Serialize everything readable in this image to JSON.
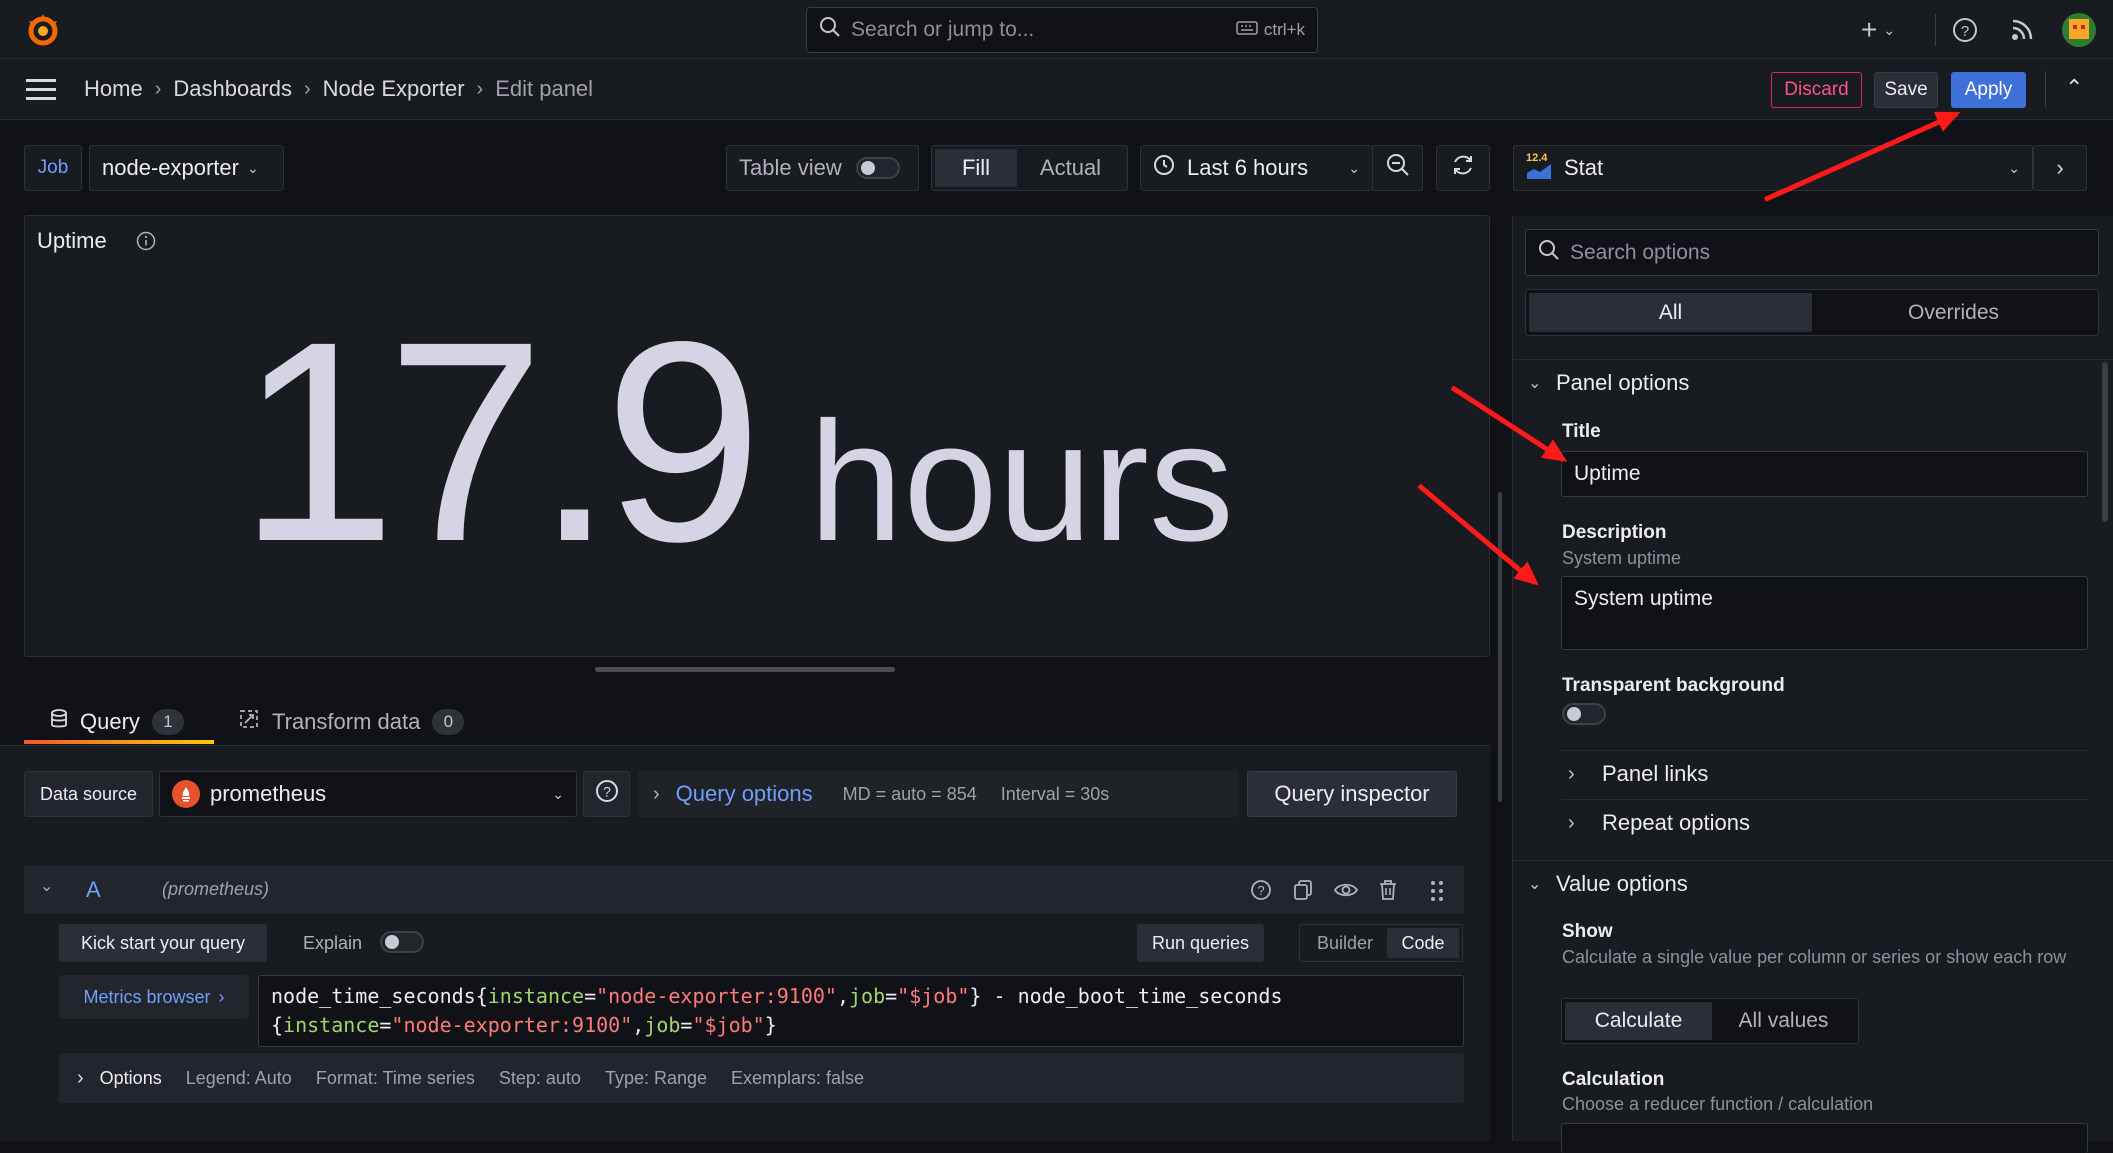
{
  "colors": {
    "accent": "#3d71d9",
    "discard": "#ff5286",
    "query_tab_underline": "#f05a28",
    "link_blue": "#6e9fff"
  },
  "topbar": {
    "search_placeholder": "Search or jump to...",
    "shortcut": "ctrl+k"
  },
  "breadcrumb": {
    "items": [
      "Home",
      "Dashboards",
      "Node Exporter"
    ],
    "current": "Edit panel"
  },
  "actions": {
    "discard": "Discard",
    "save": "Save",
    "apply": "Apply"
  },
  "variables": {
    "label": "Job",
    "value": "node-exporter"
  },
  "toolbar": {
    "table_view": "Table view",
    "fill": "Fill",
    "actual": "Actual",
    "time_range": "Last 6 hours"
  },
  "visualization": {
    "version": "12.4",
    "name": "Stat"
  },
  "panel": {
    "title": "Uptime",
    "value": "17.9",
    "unit": "hours"
  },
  "tabs": {
    "query": "Query",
    "query_count": "1",
    "transform": "Transform data",
    "transform_count": "0"
  },
  "datasource": {
    "label": "Data source",
    "name": "prometheus",
    "query_options": "Query options",
    "md": "MD = auto = 854",
    "interval": "Interval = 30s",
    "inspector": "Query inspector"
  },
  "query": {
    "ref": "A",
    "ds_hint": "(prometheus)",
    "kick_start": "Kick start your query",
    "explain": "Explain",
    "run": "Run queries",
    "builder": "Builder",
    "code": "Code",
    "metrics_browser": "Metrics browser",
    "line1_metric": "node_time_seconds{",
    "line1_k1": "instance",
    "line1_v1": "\"node-exporter:9100\"",
    "line1_k2": "job",
    "line1_v2": "\"$job\"",
    "line1_rest": "} - node_boot_time_seconds",
    "line2_k1": "instance",
    "line2_v1": "\"node-exporter:9100\"",
    "line2_k2": "job",
    "line2_v2": "\"$job\"",
    "options_label": "Options",
    "opt_legend": "Legend: Auto",
    "opt_format": "Format: Time series",
    "opt_step": "Step: auto",
    "opt_type": "Type: Range",
    "opt_exemplars": "Exemplars: false"
  },
  "options_pane": {
    "search_placeholder": "Search options",
    "tab_all": "All",
    "tab_overrides": "Overrides",
    "panel_options": "Panel options",
    "title_label": "Title",
    "title_value": "Uptime",
    "desc_label": "Description",
    "desc_hint": "System uptime",
    "desc_value": "System uptime",
    "transparent_label": "Transparent background",
    "panel_links": "Panel links",
    "repeat_options": "Repeat options",
    "value_options": "Value options",
    "show_label": "Show",
    "show_desc": "Calculate a single value per column or series or show each row",
    "calculate": "Calculate",
    "all_values": "All values",
    "calculation_label": "Calculation",
    "calculation_desc": "Choose a reducer function / calculation"
  }
}
